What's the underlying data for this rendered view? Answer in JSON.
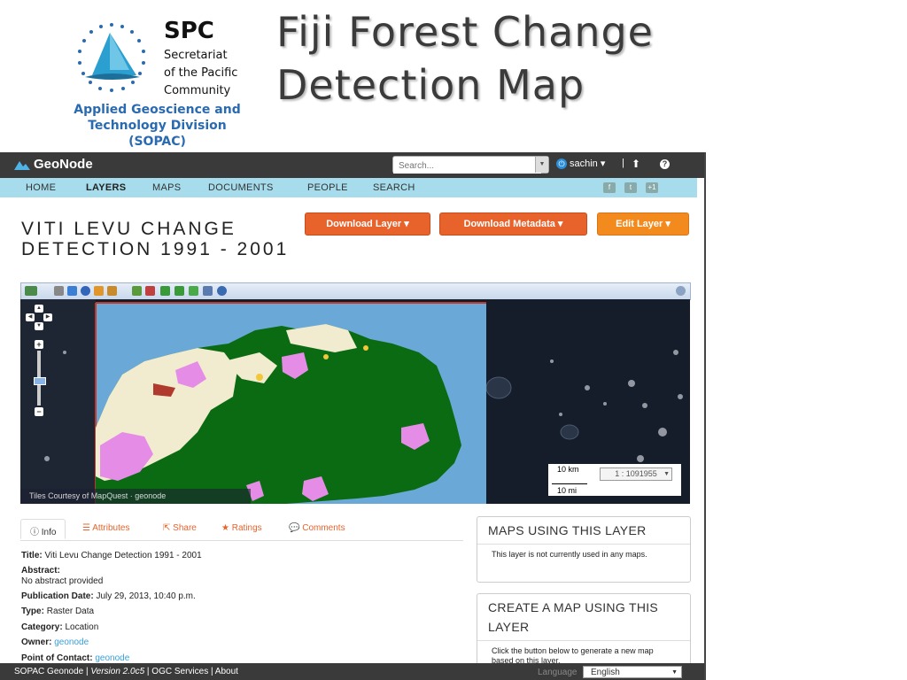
{
  "slide": {
    "title": "Fiji Forest Change Detection Map",
    "logo": {
      "org": "SPC",
      "lines": [
        "Secretariat",
        "of the Pacific",
        "Community"
      ],
      "division": "Applied Geoscience and Technology Division (SOPAC)"
    }
  },
  "geonode": {
    "brand": "GeoNode",
    "search_placeholder": "Search...",
    "user": "sachin",
    "separator": "|",
    "nav": [
      "HOME",
      "LAYERS",
      "MAPS",
      "DOCUMENTS",
      "PEOPLE",
      "SEARCH"
    ],
    "active_nav": "LAYERS",
    "layer_title": "VITI LEVU CHANGE DETECTION 1991 - 2001",
    "buttons": {
      "download_layer": "Download Layer",
      "download_metadata": "Download Metadata",
      "edit_layer": "Edit Layer"
    },
    "map": {
      "scale_km": "10 km",
      "scale_mi": "10 mi",
      "scale_ratio": "1 : 1091955",
      "attribution": "Tiles Courtesy of MapQuest · geonode"
    },
    "tabs": [
      "Info",
      "Attributes",
      "Share",
      "Ratings",
      "Comments"
    ],
    "info": {
      "title_label": "Title:",
      "title_value": "Viti Levu Change Detection 1991 - 2001",
      "abstract_label": "Abstract:",
      "abstract_value": "No abstract provided",
      "pubdate_label": "Publication Date:",
      "pubdate_value": "July 29, 2013, 10:40 p.m.",
      "type_label": "Type:",
      "type_value": "Raster Data",
      "category_label": "Category:",
      "category_value": "Location",
      "owner_label": "Owner:",
      "owner_value": "geonode",
      "poc_label": "Point of Contact:",
      "poc_value": "geonode"
    },
    "maps_panel": {
      "title": "MAPS USING THIS LAYER",
      "body": "This layer is not currently used in any maps."
    },
    "create_panel": {
      "title": "CREATE A MAP USING THIS LAYER",
      "body": "Click the button below to generate a new map based on this layer."
    },
    "footer": {
      "text_a": "SOPAC Geonode | ",
      "version": "Version 2.0c5",
      "text_b": " | OGC Services | About",
      "language_label": "Language",
      "language_value": "English"
    }
  },
  "colors": {
    "topbar": "#3a3a3a",
    "navbar": "#a6dcec",
    "button_red": "#e8632c",
    "button_orange": "#f38a1e",
    "forest": "#0b6b12",
    "nonforest": "#f1ecd0",
    "change": "#e58de6",
    "sea": "#6aa8d8"
  }
}
